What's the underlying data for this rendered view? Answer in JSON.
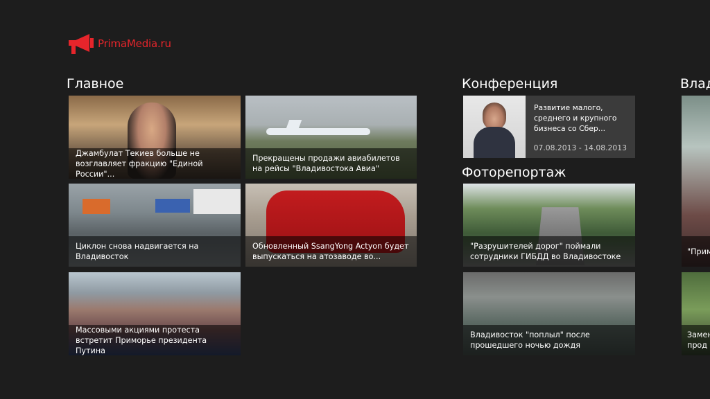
{
  "app": {
    "logo_text": "PrimaMedia.ru",
    "brand_color": "#e6252b"
  },
  "sections": {
    "main": {
      "title": "Главное",
      "tiles": [
        {
          "caption": "Джамбулат Текиев больше не возглавляет фракцию \"Единой России\"..."
        },
        {
          "caption": "Прекращены продажи авиабилетов на рейсы \"Владивостока Авиа\""
        },
        {
          "caption": "Циклон снова надвигается на Владивосток"
        },
        {
          "caption": "Обновленный SsangYong Actyon будет выпускаться на атозаводе во..."
        },
        {
          "caption": "Массовыми акциями протеста встретит Приморье президента Путина"
        }
      ]
    },
    "conference": {
      "title": "Конференция",
      "item": {
        "title": "Развитие малого, среднего и крупного бизнеса со Сбер...",
        "dates": "07.08.2013 - 14.08.2013"
      }
    },
    "photo": {
      "title": "Фоторепортаж",
      "tiles": [
        {
          "caption": "\"Разрушителей дорог\" поймали сотрудники ГИБДД во Владивостоке"
        },
        {
          "caption": "Владивосток \"поплыл\" после прошедшего ночью дождя"
        }
      ]
    },
    "third": {
      "title": "Влади",
      "tiles": [
        {
          "caption": "\"Прим"
        },
        {
          "caption": "Замен прод"
        }
      ]
    }
  }
}
